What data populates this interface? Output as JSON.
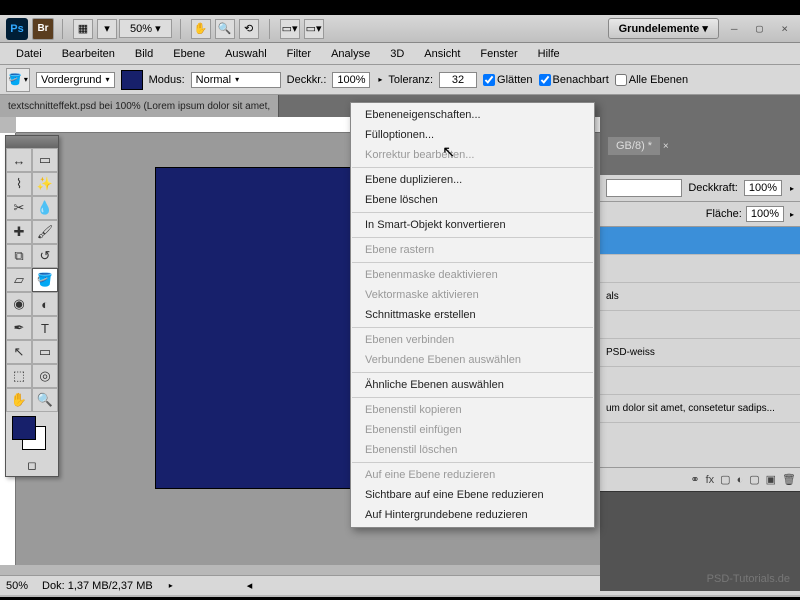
{
  "titlebar": {
    "zoom": "50%",
    "workspace": "Grundelemente ▾"
  },
  "menubar": [
    "Datei",
    "Bearbeiten",
    "Bild",
    "Ebene",
    "Auswahl",
    "Filter",
    "Analyse",
    "3D",
    "Ansicht",
    "Fenster",
    "Hilfe"
  ],
  "options": {
    "fill_target": "Vordergrund",
    "mode_label": "Modus:",
    "mode_value": "Normal",
    "opacity_label": "Deckkr.:",
    "opacity_value": "100%",
    "tolerance_label": "Toleranz:",
    "tolerance_value": "32",
    "antialias": "Glätten",
    "contiguous": "Benachbart",
    "all_layers": "Alle Ebenen"
  },
  "docs": {
    "tab1": "textschnitteffekt.psd bei 100% (Lorem ipsum dolor sit amet,",
    "tab2": "GB/8) *"
  },
  "context_menu": [
    {
      "t": "Ebeneneigenschaften...",
      "d": false
    },
    {
      "t": "Fülloptionen...",
      "d": false
    },
    {
      "t": "Korrektur bearbeiten...",
      "d": true
    },
    {
      "sep": true
    },
    {
      "t": "Ebene duplizieren...",
      "d": false
    },
    {
      "t": "Ebene löschen",
      "d": false
    },
    {
      "sep": true
    },
    {
      "t": "In Smart-Objekt konvertieren",
      "d": false
    },
    {
      "sep": true
    },
    {
      "t": "Ebene rastern",
      "d": true
    },
    {
      "sep": true
    },
    {
      "t": "Ebenenmaske deaktivieren",
      "d": true
    },
    {
      "t": "Vektormaske aktivieren",
      "d": true
    },
    {
      "t": "Schnittmaske erstellen",
      "d": false
    },
    {
      "sep": true
    },
    {
      "t": "Ebenen verbinden",
      "d": true
    },
    {
      "t": "Verbundene Ebenen auswählen",
      "d": true
    },
    {
      "sep": true
    },
    {
      "t": "Ähnliche Ebenen auswählen",
      "d": false
    },
    {
      "sep": true
    },
    {
      "t": "Ebenenstil kopieren",
      "d": true
    },
    {
      "t": "Ebenenstil einfügen",
      "d": true
    },
    {
      "t": "Ebenenstil löschen",
      "d": true
    },
    {
      "sep": true
    },
    {
      "t": "Auf eine Ebene reduzieren",
      "d": true
    },
    {
      "t": "Sichtbare auf eine Ebene reduzieren",
      "d": false
    },
    {
      "t": "Auf Hintergrundebene reduzieren",
      "d": false
    }
  ],
  "layers_panel": {
    "opacity_label": "Deckkraft:",
    "opacity_value": "100%",
    "fill_label": "Fläche:",
    "fill_value": "100%",
    "rows": [
      "",
      "",
      "als",
      "",
      "PSD-weiss",
      "",
      "um dolor sit amet, consetetur sadips..."
    ]
  },
  "status": {
    "zoom": "50%",
    "docsize": "Dok: 1,37 MB/2,37 MB"
  },
  "watermark": "PSD-Tutorials.de"
}
